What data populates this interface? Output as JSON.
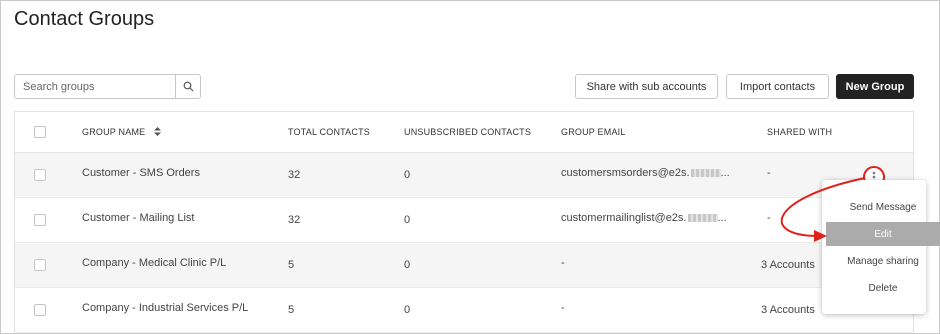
{
  "page": {
    "title": "Contact Groups"
  },
  "search": {
    "placeholder": "Search groups",
    "icon": "search-icon"
  },
  "toolbar": {
    "share_label": "Share with sub accounts",
    "import_label": "Import contacts",
    "new_group_label": "New Group"
  },
  "table": {
    "headers": {
      "group_name": "GROUP NAME",
      "total_contacts": "TOTAL CONTACTS",
      "unsubscribed_contacts": "UNSUBSCRIBED CONTACTS",
      "group_email": "GROUP EMAIL",
      "shared_with": "SHARED WITH"
    },
    "rows": [
      {
        "name": "Customer - SMS Orders",
        "total": "32",
        "unsubscribed": "0",
        "email": "customersmsorders@e2s.",
        "email_suffix": "...",
        "shared": "-"
      },
      {
        "name": "Customer - Mailing List",
        "total": "32",
        "unsubscribed": "0",
        "email": "customermailinglist@e2s.",
        "email_suffix": "...",
        "shared": "-"
      },
      {
        "name": "Company - Medical Clinic P/L",
        "total": "5",
        "unsubscribed": "0",
        "email": "-",
        "email_suffix": "",
        "shared": "3 Accounts"
      },
      {
        "name": "Company - Industrial Services P/L",
        "total": "5",
        "unsubscribed": "0",
        "email": "-",
        "email_suffix": "",
        "shared": "3 Accounts"
      }
    ]
  },
  "context_menu": {
    "items": [
      "Send Message",
      "Edit",
      "Manage sharing",
      "Delete"
    ],
    "active": "Edit"
  },
  "colors": {
    "annotation": "#e0201a",
    "primary_button": "#222222",
    "menu_highlight": "#ababab"
  }
}
